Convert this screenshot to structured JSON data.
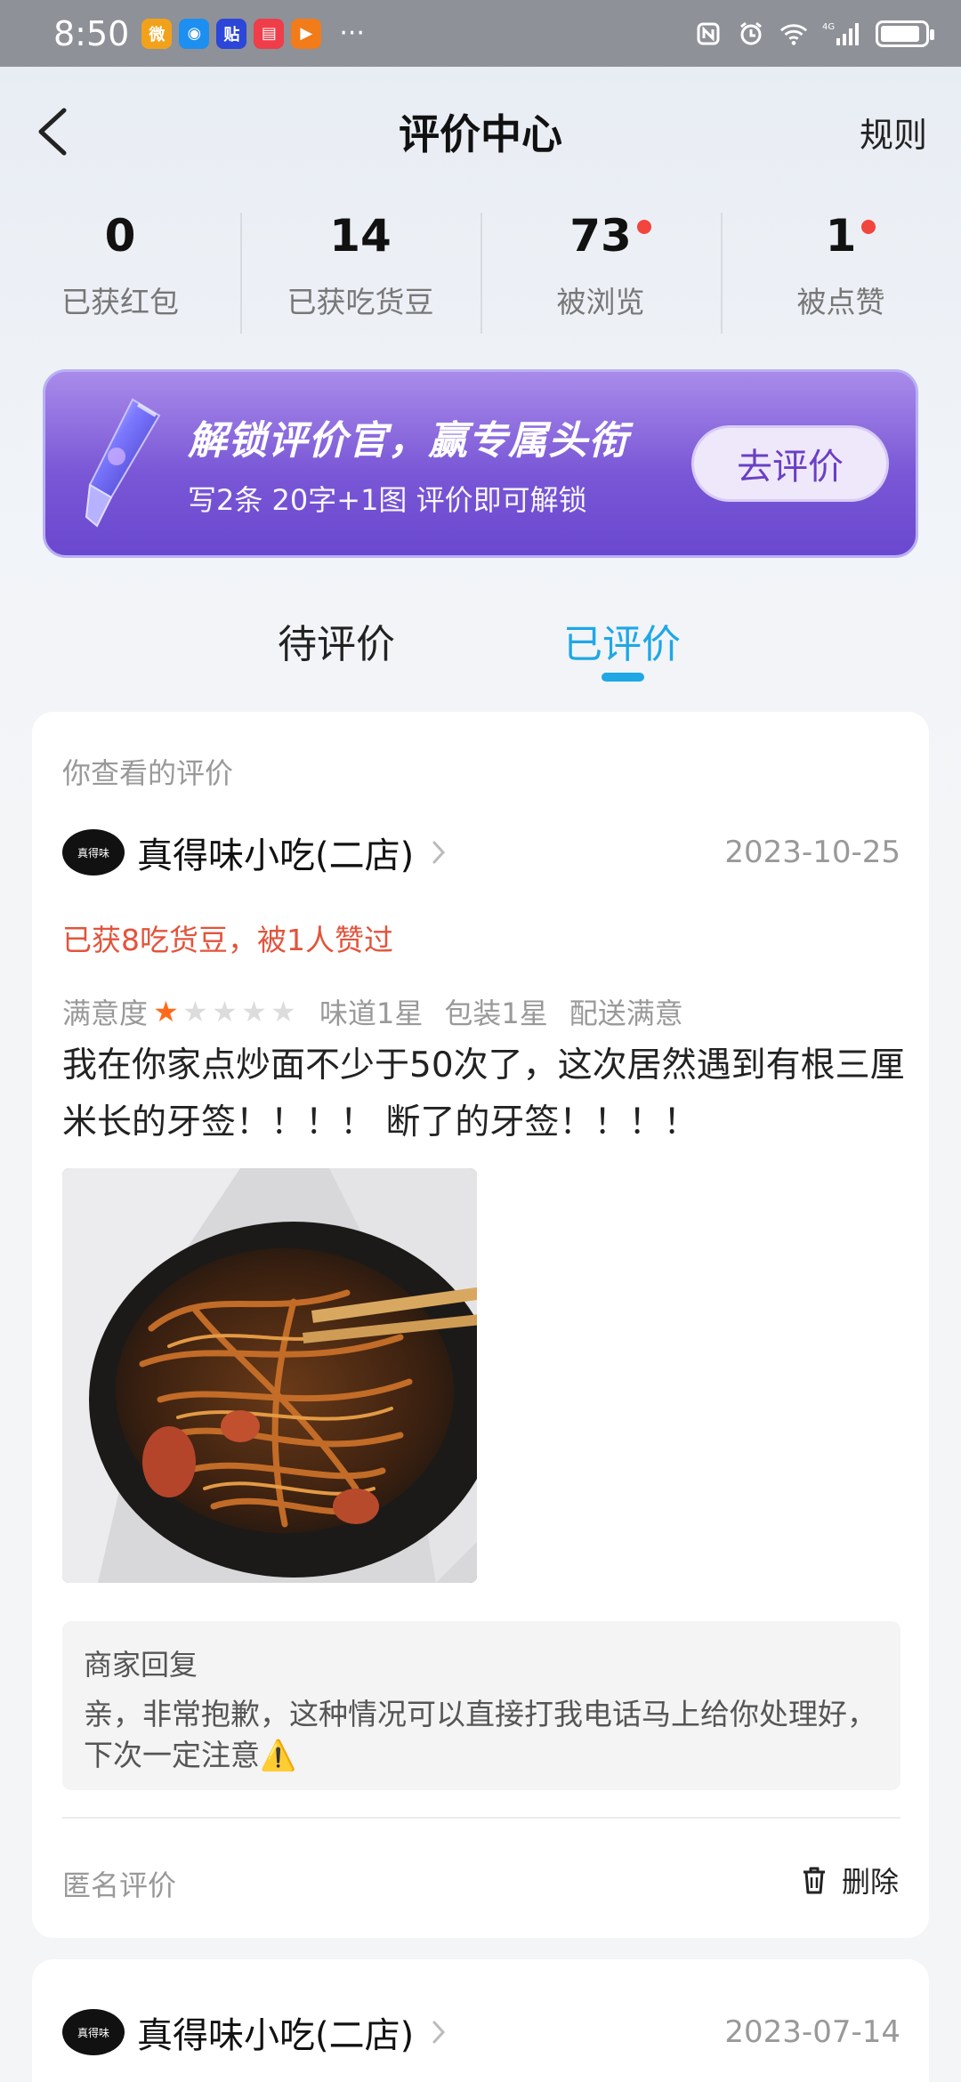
{
  "status_bar": {
    "time": "8:50",
    "apps": [
      {
        "icon": "weibo-icon",
        "color": "#f2a21a",
        "glyph": "微"
      },
      {
        "icon": "compass-app-icon",
        "color": "#1d8ff0",
        "glyph": "◉"
      },
      {
        "icon": "tieba-app-icon",
        "color": "#2c46d9",
        "glyph": "贴"
      },
      {
        "icon": "reader-app-icon",
        "color": "#ef3d49",
        "glyph": "▤"
      },
      {
        "icon": "video-app-icon",
        "color": "#f27b1a",
        "glyph": "▶"
      }
    ],
    "more": "···",
    "signal_label": "4G"
  },
  "header": {
    "title": "评价中心",
    "rules": "规则"
  },
  "stats": [
    {
      "value": "0",
      "label": "已获红包",
      "dot": false
    },
    {
      "value": "14",
      "label": "已获吃货豆",
      "dot": false
    },
    {
      "value": "73",
      "label": "被浏览",
      "dot": true
    },
    {
      "value": "1",
      "label": "被点赞",
      "dot": true
    }
  ],
  "banner": {
    "title": "解锁评价官，赢专属头衔",
    "subtitle": "写2条 20字+1图 评价即可解锁",
    "button": "去评价"
  },
  "tabs": {
    "pending": "待评价",
    "done": "已评价",
    "active": "done"
  },
  "review": {
    "viewed_label": "你查看的评价",
    "shop_name": "真得味小吃(二店)",
    "shop_logo_text": "真得味",
    "date": "2023-10-25",
    "earned": "已获8吃货豆，被1人赞过",
    "satisfaction_label": "满意度",
    "stars": 1,
    "stars_max": 5,
    "taste": "味道1星",
    "packaging": "包装1星",
    "delivery": "配送满意",
    "text": "我在你家点炒面不少于50次了，这次居然遇到有根三厘米长的牙签！！！！ 断了的牙签！！！！",
    "merchant_reply_title": "商家回复",
    "merchant_reply": "亲，非常抱歉，这种情况可以直接打我电话马上给你处理好，下次一定注意⚠️",
    "anonymous_label": "匿名评价",
    "delete_label": "删除"
  },
  "review2": {
    "shop_name": "真得味小吃(二店)",
    "shop_logo_text": "真得味",
    "date": "2023-07-14"
  }
}
